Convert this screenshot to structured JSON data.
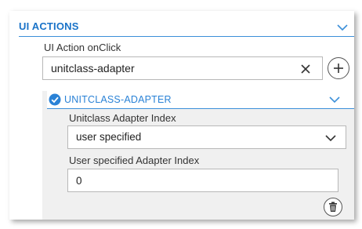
{
  "section": {
    "title": "UI ACTIONS"
  },
  "onclick": {
    "label": "UI Action onClick",
    "value": "unitclass-adapter"
  },
  "item": {
    "title": "UNITCLASS-ADAPTER",
    "index_label": "Unitclass Adapter Index",
    "index_value": "user specified",
    "specified_label": "User specified Adapter Index",
    "specified_value": "0"
  },
  "colors": {
    "accent": "#1a73c8",
    "check_circle": "#2a82d6",
    "sub_background": "#f0f0f0"
  }
}
